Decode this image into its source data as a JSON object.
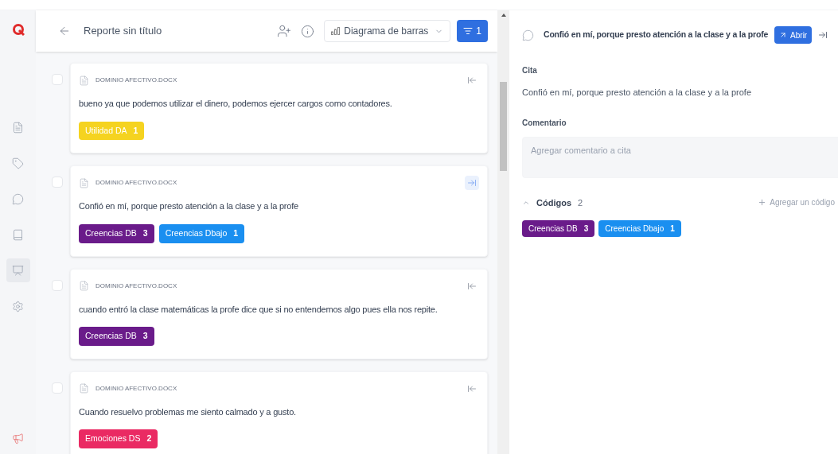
{
  "sidebar": {
    "items": [
      {
        "kind": "document",
        "selected": false
      },
      {
        "kind": "tag",
        "selected": false
      },
      {
        "kind": "comment",
        "selected": false
      },
      {
        "kind": "book",
        "selected": false
      },
      {
        "kind": "report",
        "selected": true
      },
      {
        "kind": "settings",
        "selected": false
      }
    ]
  },
  "header": {
    "title": "Reporte sin título",
    "chart_select": "Diagrama de barras",
    "filter_count": "1"
  },
  "quotes": [
    {
      "document": "DOMINIO AFECTIVO.DOCX",
      "text": "bueno ya que podemos utilizar el dinero, podemos ejercer cargos como contadores.",
      "selected": false,
      "checked": false,
      "codes": [
        {
          "name": "Utilidad DA",
          "count": "1",
          "color": "#f5d320"
        }
      ]
    },
    {
      "document": "DOMINIO AFECTIVO.DOCX",
      "text": "Confió en mí, porque presto atención a la clase y a la profe",
      "selected": true,
      "checked": false,
      "codes": [
        {
          "name": "Creencias DB",
          "count": "3",
          "color": "#6a1b8a"
        },
        {
          "name": "Creencias Dbajo",
          "count": "1",
          "color": "#1a8ff0"
        }
      ]
    },
    {
      "document": "DOMINIO AFECTIVO.DOCX",
      "text": "cuando entró la clase matemáticas la profe dice que si no entendemos algo pues ella nos repite.",
      "selected": false,
      "checked": false,
      "codes": [
        {
          "name": "Creencias DB",
          "count": "3",
          "color": "#6a1b8a"
        }
      ]
    },
    {
      "document": "DOMINIO AFECTIVO.DOCX",
      "text": "Cuando resuelvo problemas me siento calmado y a gusto.",
      "selected": false,
      "checked": false,
      "codes": [
        {
          "name": "Emociones DS",
          "count": "2",
          "color": "#ea2a63"
        }
      ]
    }
  ],
  "detail": {
    "title": "Confió en mí, porque presto atención a la clase y a la profe",
    "open_button": "Abrir",
    "quote_label": "Cita",
    "quote_text": "Confió en mí, porque presto atención a la clase y a la profe",
    "comment_label": "Comentario",
    "comment_placeholder": "Agregar comentario a cita",
    "codes_label": "Códigos",
    "codes_count": "2",
    "codes_expanded": true,
    "add_code": "Agregar un código",
    "codes": [
      {
        "name": "Creencias DB",
        "count": "3",
        "color": "#6a1b8a"
      },
      {
        "name": "Creencias Dbajo",
        "count": "1",
        "color": "#1a8ff0"
      }
    ]
  }
}
